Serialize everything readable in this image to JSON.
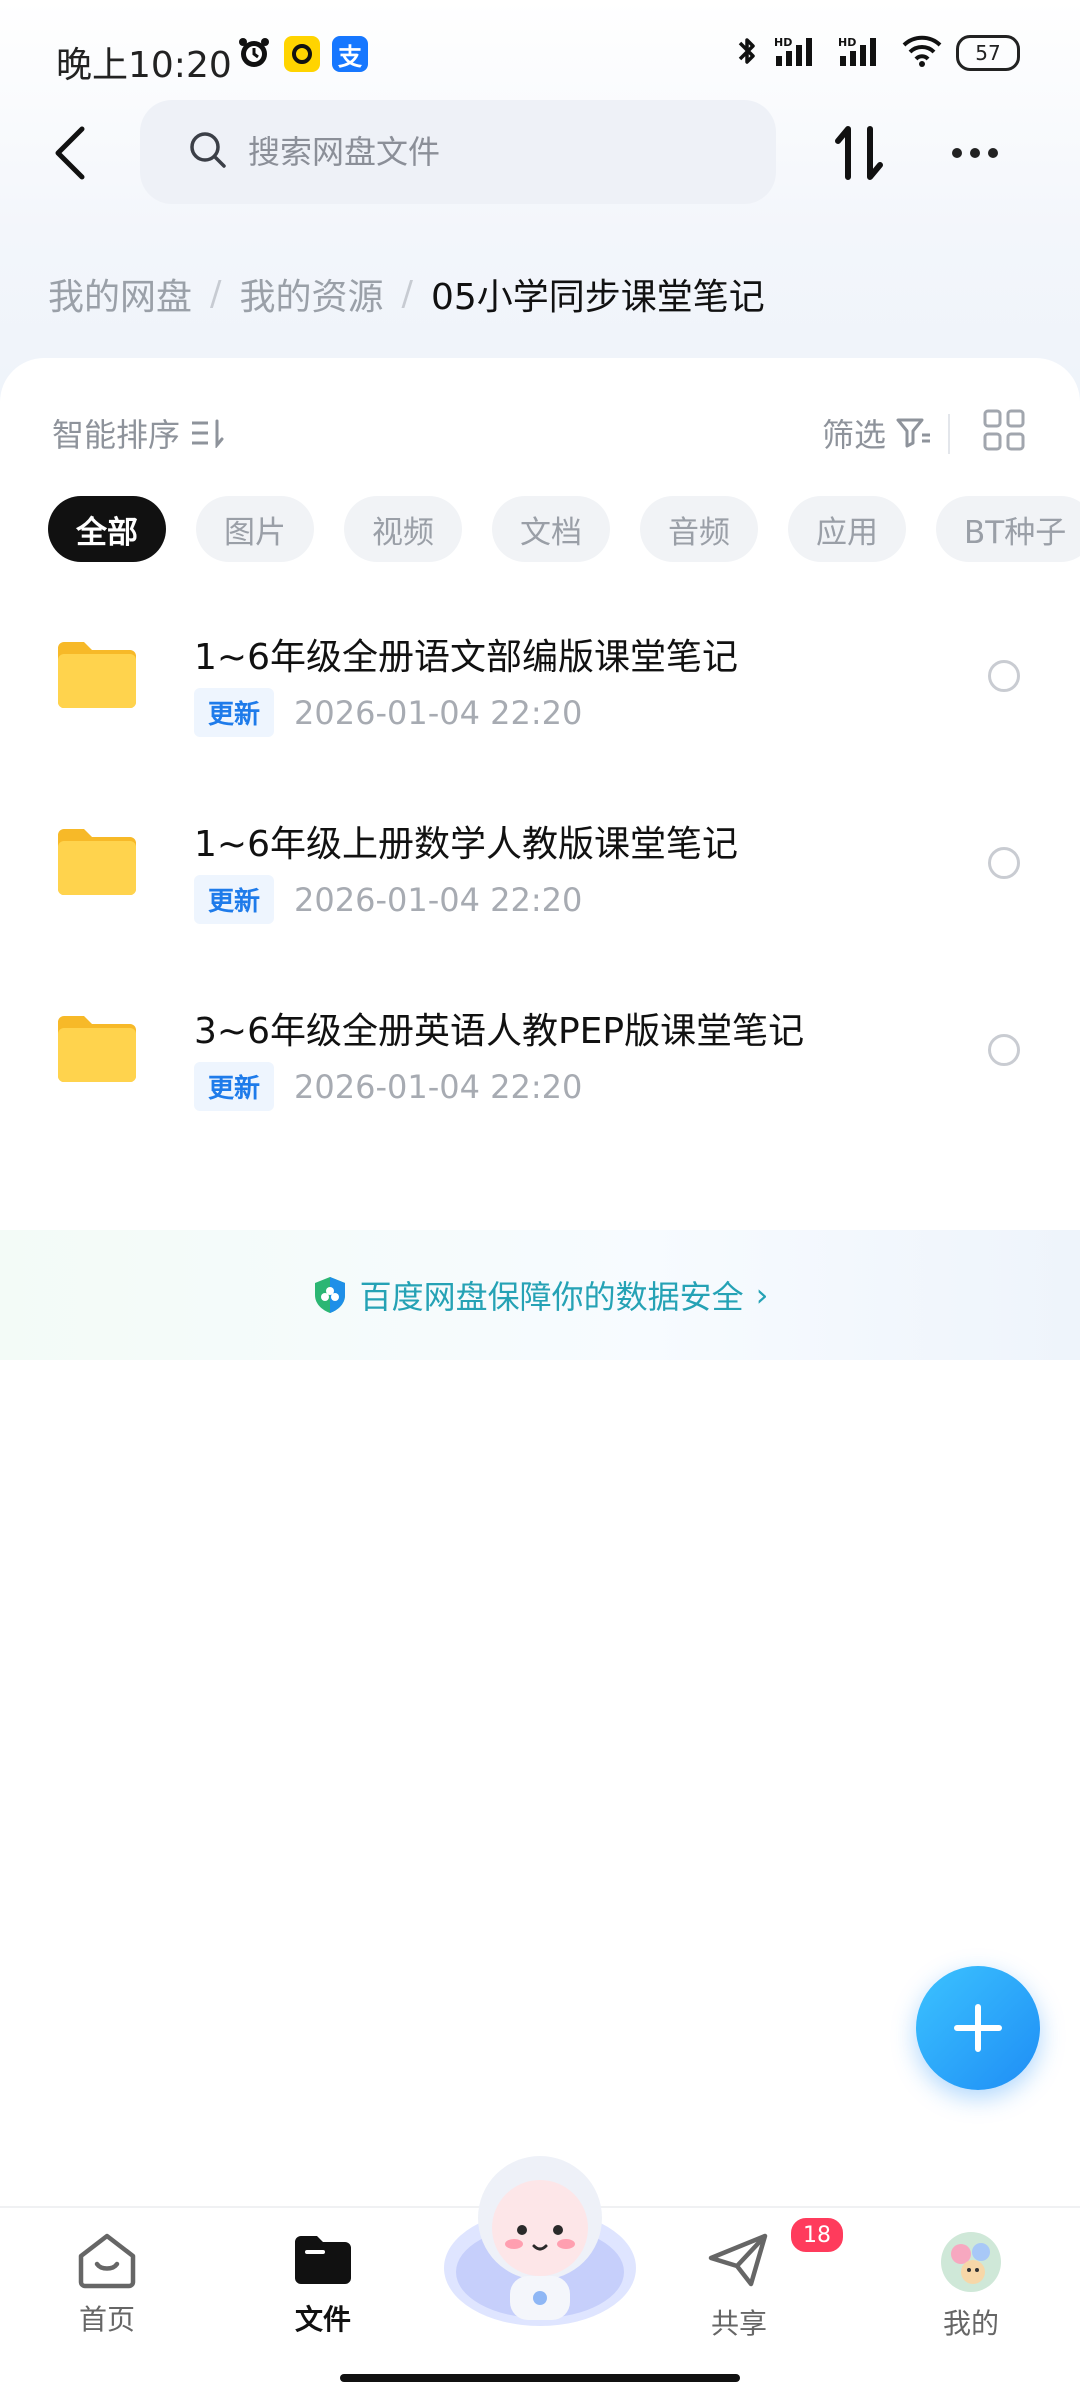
{
  "status_bar": {
    "time": "晚上10:20",
    "battery": "57",
    "app_icons": [
      "alarm-icon",
      "app-o-icon",
      "alipay-icon"
    ],
    "alipay_glyph": "支",
    "right_icons": [
      "bluetooth-icon",
      "signal-hd-1-icon",
      "signal-hd-2-icon",
      "wifi-icon",
      "battery-icon"
    ]
  },
  "header": {
    "search_placeholder": "搜索网盘文件"
  },
  "breadcrumb": {
    "items": [
      "我的网盘",
      "我的资源",
      "05小学同步课堂笔记"
    ],
    "separator": "/"
  },
  "toolbar": {
    "sort_label": "智能排序",
    "filter_label": "筛选"
  },
  "chips": [
    "全部",
    "图片",
    "视频",
    "文档",
    "音频",
    "应用",
    "BT种子"
  ],
  "files": [
    {
      "name": "1~6年级全册语文部编版课堂笔记",
      "badge": "更新",
      "date": "2026-01-04  22:20"
    },
    {
      "name": "1~6年级上册数学人教版课堂笔记",
      "badge": "更新",
      "date": "2026-01-04  22:20"
    },
    {
      "name": "3~6年级全册英语人教PEP版课堂笔记",
      "badge": "更新",
      "date": "2026-01-04  22:20"
    }
  ],
  "safety_banner": {
    "text": "百度网盘保障你的数据安全",
    "arrow": "›"
  },
  "bottom_nav": {
    "items": [
      {
        "label": "首页"
      },
      {
        "label": "文件"
      },
      {
        "label": "共享",
        "badge": "18"
      },
      {
        "label": "我的"
      }
    ]
  },
  "colors": {
    "accent": "#1e8df5",
    "chip_active": "#111111",
    "update_badge": "#1e7bea",
    "notification": "#ff3b5c",
    "folder": "#ffc93c"
  }
}
